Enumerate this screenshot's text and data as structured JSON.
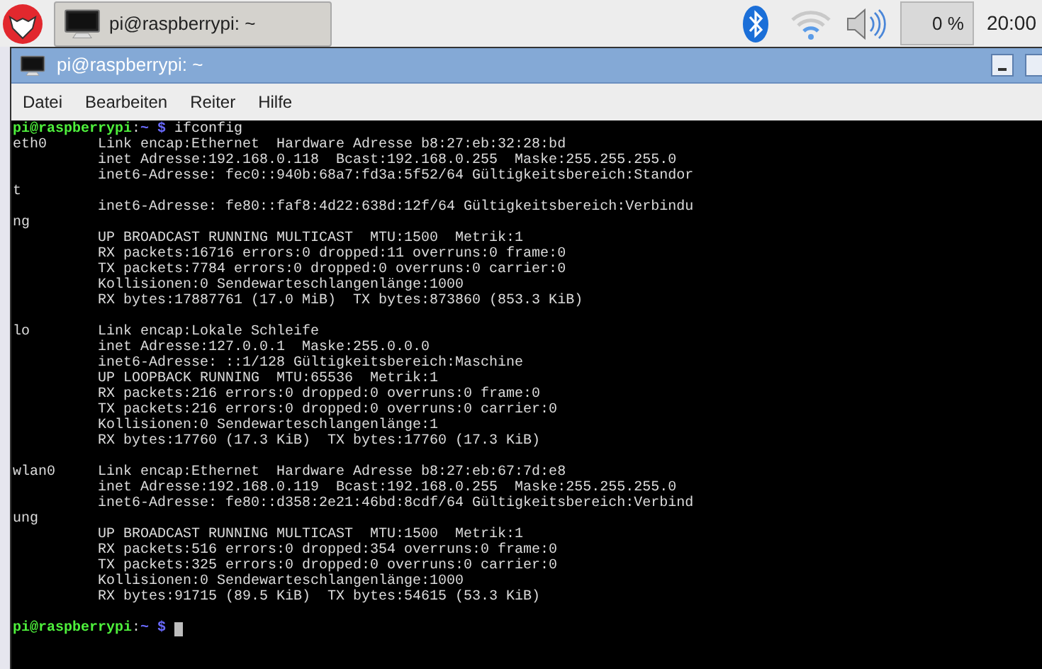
{
  "taskbar": {
    "task_button": {
      "title": "pi@raspberrypi: ~",
      "selected": true
    },
    "cpu": "0 %",
    "clock": "20:00"
  },
  "window": {
    "title": "pi@raspberrypi: ~"
  },
  "menu": [
    "Datei",
    "Bearbeiten",
    "Reiter",
    "Hilfe"
  ],
  "terminal": {
    "lines": [
      {
        "kind": "prompt",
        "user": "pi@raspberrypi",
        "sep": ":",
        "path": "~ $",
        "command": "ifconfig"
      },
      {
        "kind": "output",
        "text": "eth0      Link encap:Ethernet  Hardware Adresse b8:27:eb:32:28:bd"
      },
      {
        "kind": "output",
        "text": "          inet Adresse:192.168.0.118  Bcast:192.168.0.255  Maske:255.255.255.0"
      },
      {
        "kind": "output",
        "text": "          inet6-Adresse: fec0::940b:68a7:fd3a:5f52/64 Gültigkeitsbereich:Standor"
      },
      {
        "kind": "output",
        "text": "t"
      },
      {
        "kind": "output",
        "text": "          inet6-Adresse: fe80::faf8:4d22:638d:12f/64 Gültigkeitsbereich:Verbindu"
      },
      {
        "kind": "output",
        "text": "ng"
      },
      {
        "kind": "output",
        "text": "          UP BROADCAST RUNNING MULTICAST  MTU:1500  Metrik:1"
      },
      {
        "kind": "output",
        "text": "          RX packets:16716 errors:0 dropped:11 overruns:0 frame:0"
      },
      {
        "kind": "output",
        "text": "          TX packets:7784 errors:0 dropped:0 overruns:0 carrier:0"
      },
      {
        "kind": "output",
        "text": "          Kollisionen:0 Sendewarteschlangenlänge:1000"
      },
      {
        "kind": "output",
        "text": "          RX bytes:17887761 (17.0 MiB)  TX bytes:873860 (853.3 KiB)"
      },
      {
        "kind": "blank"
      },
      {
        "kind": "output",
        "text": "lo        Link encap:Lokale Schleife"
      },
      {
        "kind": "output",
        "text": "          inet Adresse:127.0.0.1  Maske:255.0.0.0"
      },
      {
        "kind": "output",
        "text": "          inet6-Adresse: ::1/128 Gültigkeitsbereich:Maschine"
      },
      {
        "kind": "output",
        "text": "          UP LOOPBACK RUNNING  MTU:65536  Metrik:1"
      },
      {
        "kind": "output",
        "text": "          RX packets:216 errors:0 dropped:0 overruns:0 frame:0"
      },
      {
        "kind": "output",
        "text": "          TX packets:216 errors:0 dropped:0 overruns:0 carrier:0"
      },
      {
        "kind": "output",
        "text": "          Kollisionen:0 Sendewarteschlangenlänge:1"
      },
      {
        "kind": "output",
        "text": "          RX bytes:17760 (17.3 KiB)  TX bytes:17760 (17.3 KiB)"
      },
      {
        "kind": "blank"
      },
      {
        "kind": "output",
        "text": "wlan0     Link encap:Ethernet  Hardware Adresse b8:27:eb:67:7d:e8"
      },
      {
        "kind": "output",
        "text": "          inet Adresse:192.168.0.119  Bcast:192.168.0.255  Maske:255.255.255.0"
      },
      {
        "kind": "output",
        "text": "          inet6-Adresse: fe80::d358:2e21:46bd:8cdf/64 Gültigkeitsbereich:Verbind"
      },
      {
        "kind": "output",
        "text": "ung"
      },
      {
        "kind": "output",
        "text": "          UP BROADCAST RUNNING MULTICAST  MTU:1500  Metrik:1"
      },
      {
        "kind": "output",
        "text": "          RX packets:516 errors:0 dropped:354 overruns:0 frame:0"
      },
      {
        "kind": "output",
        "text": "          TX packets:325 errors:0 dropped:0 overruns:0 carrier:0"
      },
      {
        "kind": "output",
        "text": "          Kollisionen:0 Sendewarteschlangenlänge:1000"
      },
      {
        "kind": "output",
        "text": "          RX bytes:91715 (89.5 KiB)  TX bytes:54615 (53.3 KiB)"
      },
      {
        "kind": "blank"
      },
      {
        "kind": "prompt",
        "user": "pi@raspberrypi",
        "sep": ":",
        "path": "~ $",
        "cursor": true
      }
    ]
  }
}
